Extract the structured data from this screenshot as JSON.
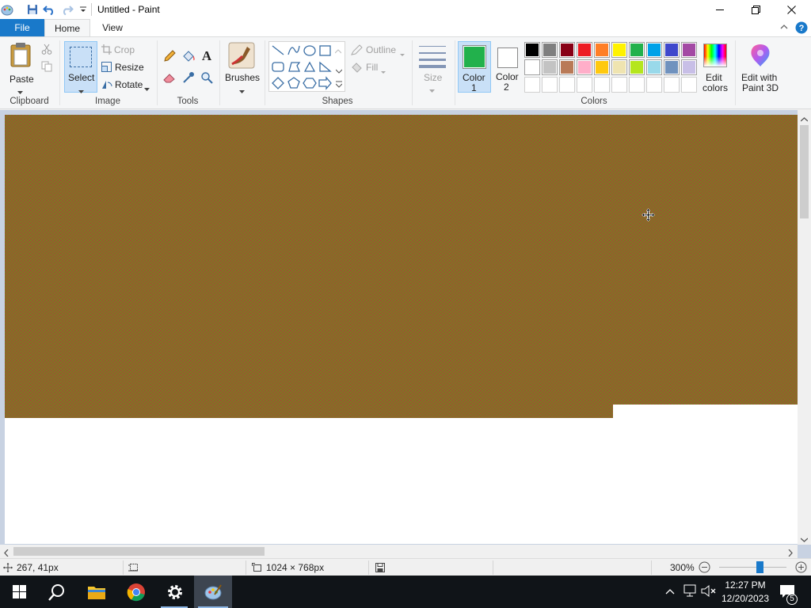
{
  "window": {
    "title": "Untitled - Paint"
  },
  "tabs": {
    "file": "File",
    "home": "Home",
    "view": "View"
  },
  "ribbon": {
    "clipboard": {
      "paste": "Paste",
      "group": "Clipboard"
    },
    "image": {
      "select": "Select",
      "crop": "Crop",
      "resize": "Resize",
      "rotate": "Rotate",
      "group": "Image"
    },
    "tools": {
      "group": "Tools"
    },
    "brushes": {
      "label": "Brushes"
    },
    "shapes": {
      "outline": "Outline",
      "fill": "Fill",
      "group": "Shapes"
    },
    "size": {
      "label": "Size"
    },
    "colors": {
      "color1_label": "Color",
      "color1_num": "1",
      "color2_label": "Color",
      "color2_num": "2",
      "color1_value": "#22b14c",
      "color2_value": "#ffffff",
      "edit_label_1": "Edit",
      "edit_label_2": "colors",
      "group": "Colors",
      "palette_row1": [
        "#000000",
        "#7f7f7f",
        "#880015",
        "#ed1c24",
        "#ff7f27",
        "#fff200",
        "#22b14c",
        "#00a2e8",
        "#3f48cc",
        "#a349a4"
      ],
      "palette_row2": [
        "#ffffff",
        "#c3c3c3",
        "#b97a57",
        "#ffaec9",
        "#ffc90e",
        "#efe4b0",
        "#b5e61d",
        "#99d9ea",
        "#7092be",
        "#c8bfe7"
      ]
    },
    "paint3d": {
      "label1": "Edit with",
      "label2": "Paint 3D"
    }
  },
  "canvas": {
    "pattern_colors": [
      "#7c7a22",
      "#9a5530"
    ]
  },
  "statusbar": {
    "cursor_pos": "267, 41px",
    "image_size": "1024 × 768px",
    "zoom": "300%",
    "zoom_fraction": 0.6
  },
  "taskbar": {
    "time": "12:27 PM",
    "date": "12/20/2023",
    "notification_count": "5"
  }
}
